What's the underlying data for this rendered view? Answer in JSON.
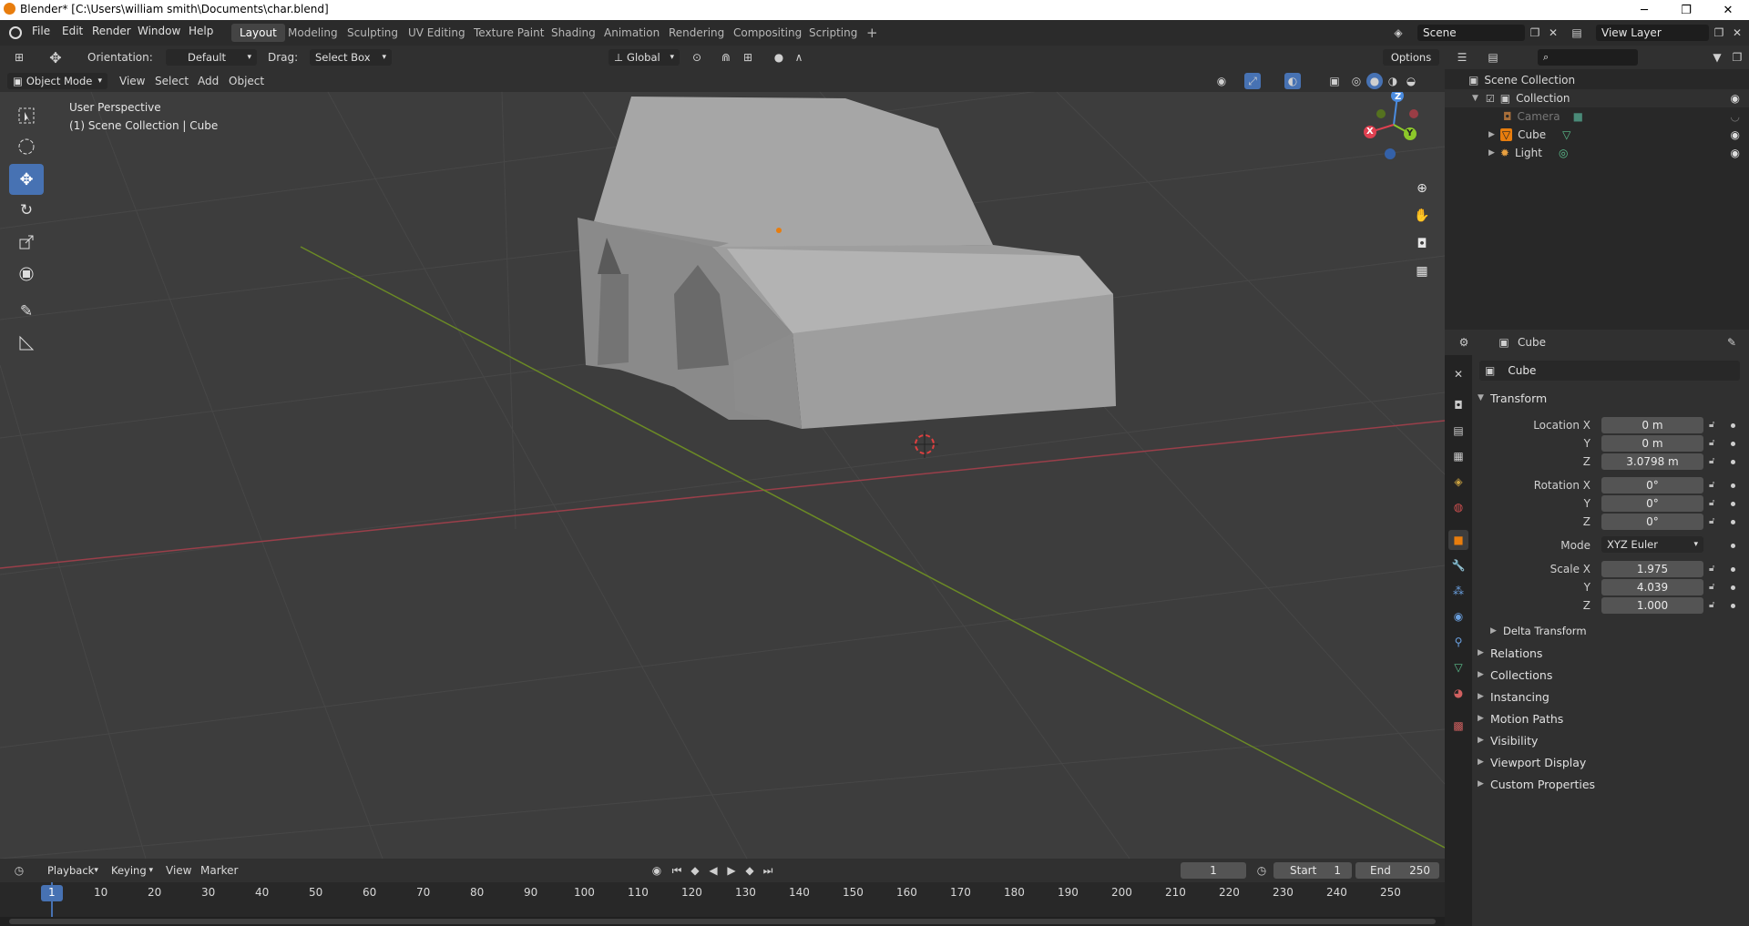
{
  "window": {
    "title": "Blender* [C:\\Users\\william smith\\Documents\\char.blend]",
    "minimize": "─",
    "maximize": "❐",
    "close": "✕"
  },
  "menu": {
    "items": [
      "File",
      "Edit",
      "Render",
      "Window",
      "Help"
    ]
  },
  "workspaces": [
    "Layout",
    "Modeling",
    "Sculpting",
    "UV Editing",
    "Texture Paint",
    "Shading",
    "Animation",
    "Rendering",
    "Compositing",
    "Scripting"
  ],
  "workspace_add": "+",
  "scene": {
    "name": "Scene",
    "view_layer": "View Layer"
  },
  "tool_header": {
    "orientation_label": "Orientation:",
    "orientation_value": "Default",
    "drag_label": "Drag:",
    "drag_value": "Select Box",
    "transform_orientation": "Global",
    "options": "Options"
  },
  "viewport_header": {
    "mode": "Object Mode",
    "menus": [
      "View",
      "Select",
      "Add",
      "Object"
    ]
  },
  "viewport": {
    "perspective": "User Perspective",
    "context": "(1) Scene Collection | Cube",
    "gizmo": {
      "x": "X",
      "y": "Y",
      "z": "Z"
    }
  },
  "outliner": {
    "root": "Scene Collection",
    "rows": [
      {
        "label": "Collection"
      },
      {
        "label": "Camera"
      },
      {
        "label": "Cube"
      },
      {
        "label": "Light"
      }
    ]
  },
  "properties": {
    "object_name": "Cube",
    "name_field": "Cube",
    "transform": {
      "title": "Transform",
      "location_label": "Location X",
      "y_label": "Y",
      "z_label": "Z",
      "location": [
        "0 m",
        "0 m",
        "3.0798 m"
      ],
      "rotation_label": "Rotation X",
      "rotation": [
        "0°",
        "0°",
        "0°"
      ],
      "mode_label": "Mode",
      "mode": "XYZ Euler",
      "scale_label": "Scale X",
      "scale": [
        "1.975",
        "4.039",
        "1.000"
      ],
      "delta": "Delta Transform"
    },
    "panels": [
      "Relations",
      "Collections",
      "Instancing",
      "Motion Paths",
      "Visibility",
      "Viewport Display",
      "Custom Properties"
    ]
  },
  "timeline": {
    "menus": [
      "Playback",
      "Keying",
      "View",
      "Marker"
    ],
    "current_frame": "1",
    "start_label": "Start",
    "start": "1",
    "end_label": "End",
    "end": "250",
    "ticks": [
      "1",
      "10",
      "20",
      "30",
      "40",
      "50",
      "60",
      "70",
      "80",
      "90",
      "100",
      "110",
      "120",
      "130",
      "140",
      "150",
      "160",
      "170",
      "180",
      "190",
      "200",
      "210",
      "220",
      "230",
      "240",
      "250"
    ]
  },
  "colors": {
    "accent": "#4772b3",
    "active_frame": "#4772b3",
    "x_axis": "#9a3f4a",
    "y_axis": "#6b8a25",
    "orange": "#e87d0d"
  }
}
